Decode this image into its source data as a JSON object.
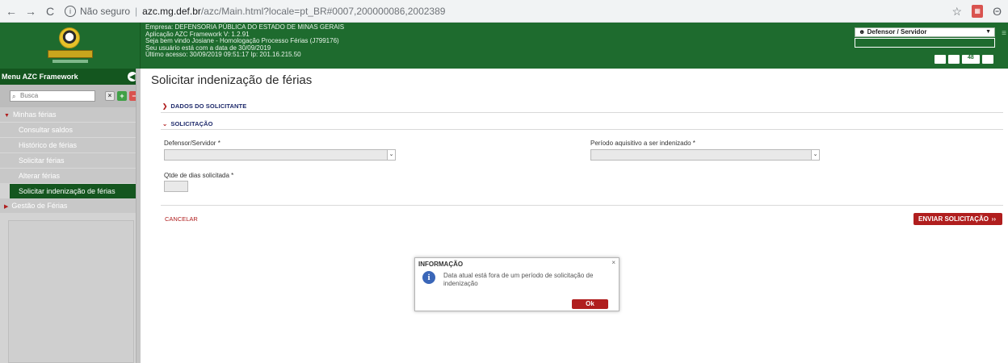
{
  "browser": {
    "info_label": "Não seguro",
    "url_host": "azc.mg.def.br",
    "url_path": "/azc/Main.html?locale=pt_BR#0007,200000086,2002389"
  },
  "header": {
    "company": "Empresa: DEFENSORIA PÚBLICA DO ESTADO DE MINAS GERAIS",
    "app": "Aplicação AZC Framework V: 1.2.91",
    "welcome": "Seja bem vindo Josiane - Homologação Processo Férias (J799176)",
    "user_date": "Seu usuário está com a data de 30/09/2019",
    "last_access": "Último acesso: 30/09/2019 09:51:17 Ip: 201.16.215.50",
    "profile": "Defensor / Servidor",
    "badge_count": "48"
  },
  "sidebar": {
    "title": "Menu AZC Framework",
    "search_placeholder": "Busca",
    "group1": "Minhas férias",
    "items": [
      {
        "label": "Consultar saldos"
      },
      {
        "label": "Histórico de férias"
      },
      {
        "label": "Solicitar férias"
      },
      {
        "label": "Alterar férias"
      },
      {
        "label": "Solicitar indenização de férias"
      }
    ],
    "group2": "Gestão de Férias"
  },
  "main": {
    "page_title": "Solicitar indenização de férias",
    "section1": "DADOS DO SOLICITANTE",
    "section2": "SOLICITAÇÃO",
    "field_defensor": "Defensor/Servidor *",
    "field_periodo": "Período aquisitivo a ser indenizado *",
    "field_qtde": "Qtde de dias solicitada *",
    "cancel": "CANCELAR",
    "send": "ENVIAR SOLICITAÇÃO"
  },
  "dialog": {
    "title": "INFORMAÇÃO",
    "message": "Data atual está fora de um período de solicitação de indenização",
    "ok": "Ok"
  }
}
